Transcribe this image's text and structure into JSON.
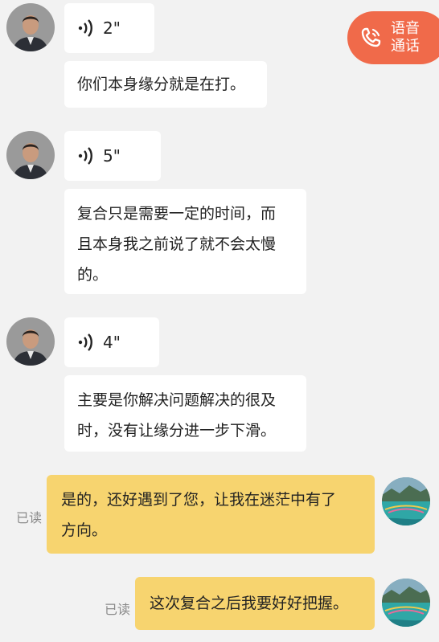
{
  "call_button": {
    "line1": "语音",
    "line2": "通话",
    "icon": "phone-icon"
  },
  "messages": [
    {
      "side": "left",
      "kind": "voice",
      "duration": "2\""
    },
    {
      "side": "left",
      "kind": "text",
      "text": "你们本身缘分就是在打。"
    },
    {
      "side": "left",
      "kind": "voice",
      "duration": "5\""
    },
    {
      "side": "left",
      "kind": "text",
      "lines": [
        "复合只是需要一定的时间，而",
        "且本身我之前说了就不会太慢",
        "的。"
      ]
    },
    {
      "side": "left",
      "kind": "voice",
      "duration": "4\""
    },
    {
      "side": "left",
      "kind": "text",
      "lines": [
        "主要是你解决问题解决的很及",
        "时，没有让缘分进一步下滑。"
      ]
    },
    {
      "side": "right",
      "kind": "text",
      "status": "已读",
      "lines": [
        "是的，还好遇到了您，让我在迷茫中有了",
        "方向。"
      ]
    },
    {
      "side": "right",
      "kind": "text",
      "status": "已读",
      "text": "这次复合之后我要好好把握。"
    }
  ],
  "colors": {
    "background": "#f2f2f2",
    "incoming_bubble": "#ffffff",
    "outgoing_bubble": "#f7d46f",
    "call_button": "#f06a4a",
    "read_label": "#8a8a8a"
  }
}
